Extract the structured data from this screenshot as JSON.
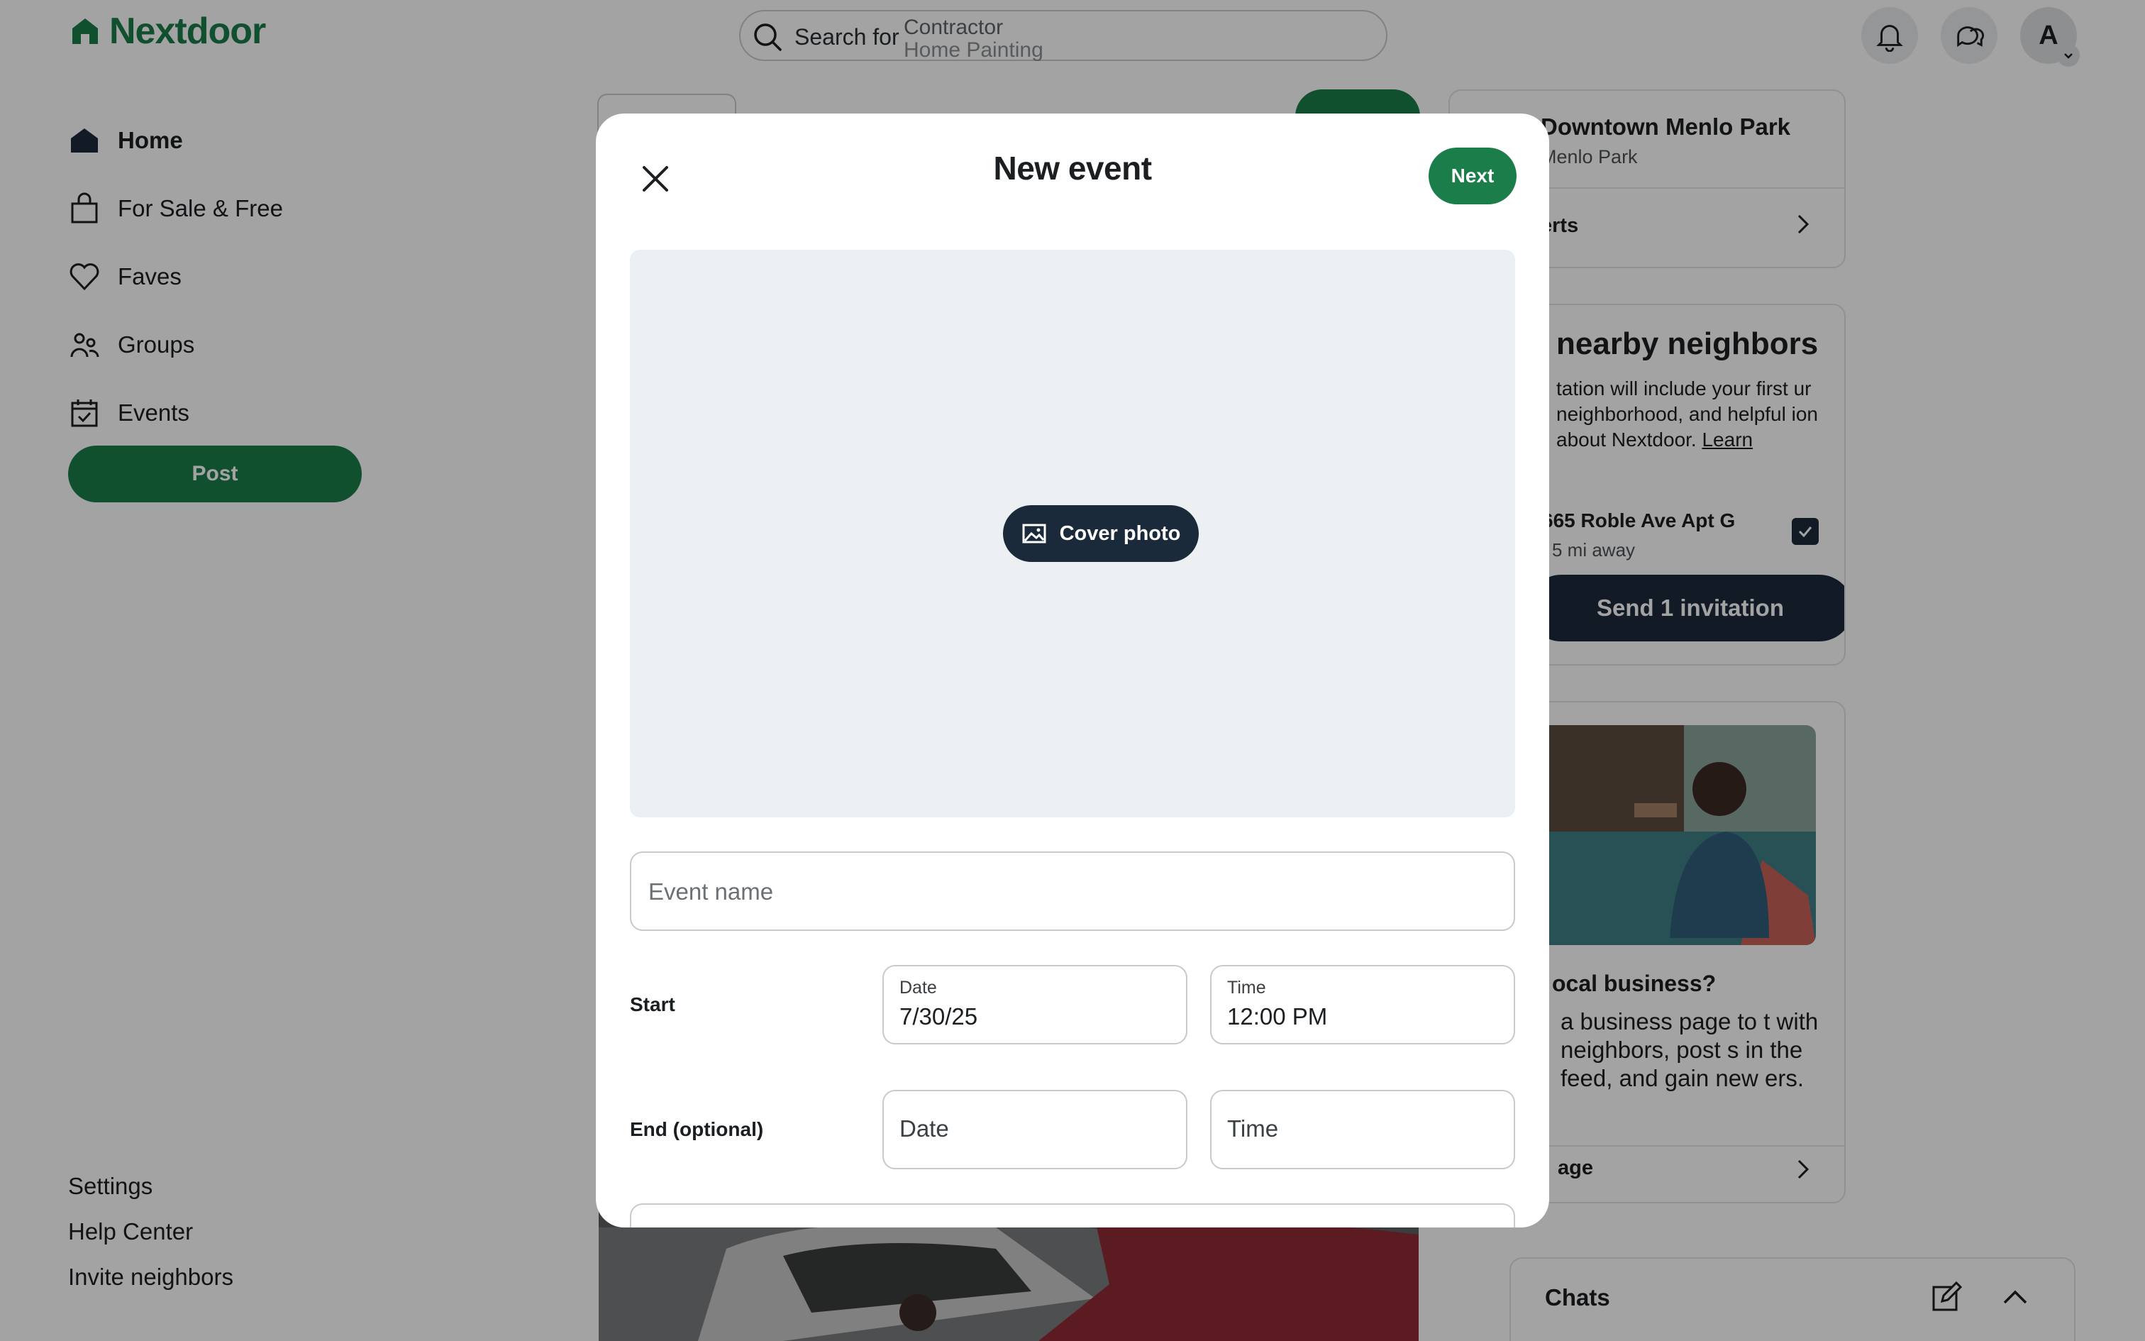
{
  "app": {
    "name": "Nextdoor",
    "brand_color": "#1a7d4a",
    "dark_color": "#1b2a3a"
  },
  "search": {
    "prefix": "Search for",
    "rotating": [
      "Contractor",
      "Home Painting"
    ]
  },
  "avatar": {
    "initial": "A"
  },
  "nav": {
    "items": [
      {
        "label": "Home",
        "icon": "home-icon",
        "active": true
      },
      {
        "label": "For Sale & Free",
        "icon": "shopping-bag-icon",
        "active": false
      },
      {
        "label": "Faves",
        "icon": "heart-icon",
        "active": false
      },
      {
        "label": "Groups",
        "icon": "groups-icon",
        "active": false
      },
      {
        "label": "Events",
        "icon": "calendar-icon",
        "active": false
      }
    ],
    "post_label": "Post"
  },
  "footer": {
    "links": [
      "Settings",
      "Help Center",
      "Invite neighbors"
    ]
  },
  "right_rail": {
    "neighborhood": {
      "title": "Downtown Menlo Park",
      "subtitle": "Menlo Park",
      "row": "erts"
    },
    "invite": {
      "title": "nearby neighbors",
      "desc": "tation will include your first ur neighborhood, and helpful ion about Nextdoor.",
      "learn": "Learn",
      "address": "665 Roble Ave Apt G",
      "distance": "5 mi away",
      "checked": true,
      "send_label": "Send 1 invitation"
    },
    "business": {
      "title": "ocal business?",
      "desc": "a business page to t with neighbors, post s in the feed, and gain new ers.",
      "row": "age"
    },
    "chats": {
      "title": "Chats"
    }
  },
  "modal": {
    "title": "New event",
    "next_label": "Next",
    "cover_label": "Cover photo",
    "event_name_placeholder": "Event name",
    "start": {
      "label": "Start",
      "date_label": "Date",
      "date_value": "7/30/25",
      "time_label": "Time",
      "time_value": "12:00 PM"
    },
    "end": {
      "label": "End (optional)",
      "date_placeholder": "Date",
      "time_placeholder": "Time"
    }
  }
}
